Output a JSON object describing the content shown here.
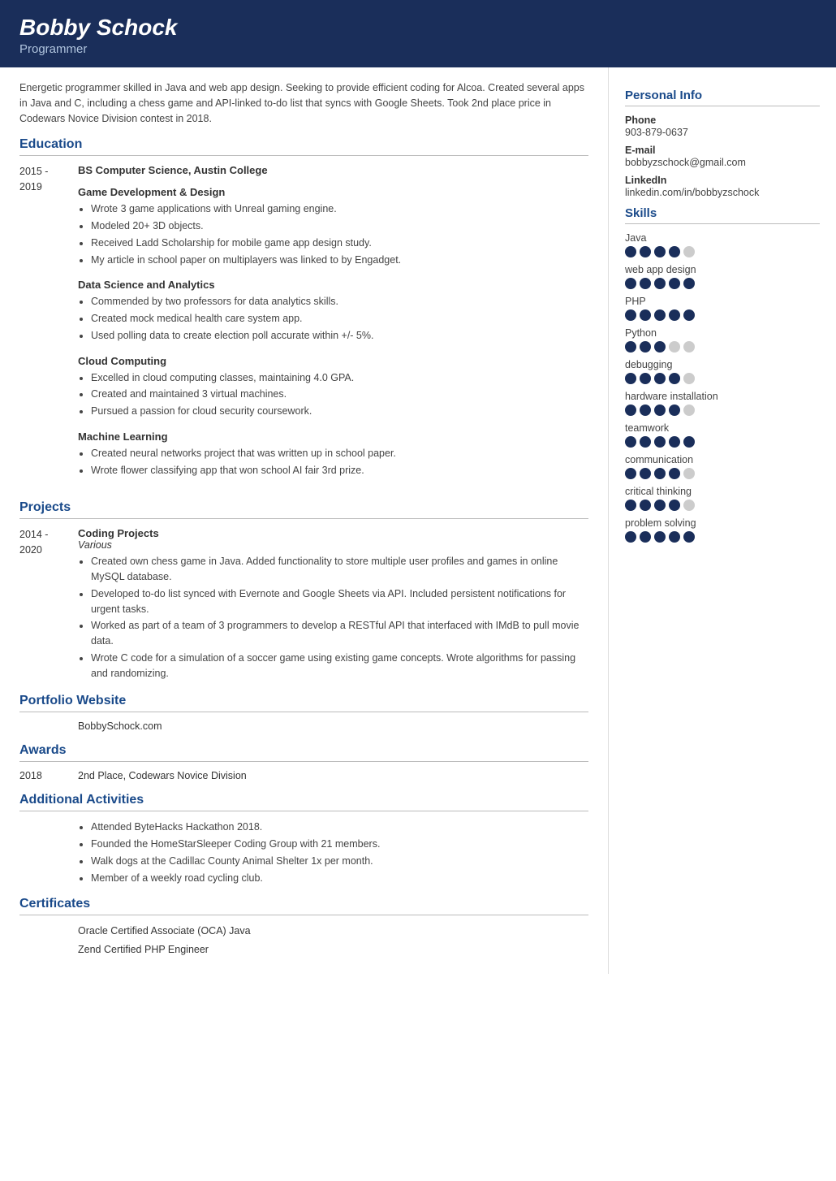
{
  "header": {
    "name": "Bobby Schock",
    "title": "Programmer"
  },
  "summary": "Energetic programmer skilled in Java and web app design. Seeking to provide efficient coding for Alcoa. Created several apps in Java and C, including a chess game and API-linked to-do list that syncs with Google Sheets. Took 2nd place price in Codewars Novice Division contest in 2018.",
  "sections": {
    "education": {
      "label": "Education",
      "entries": [
        {
          "years": "2015 -\n2019",
          "degree": "BS Computer Science, Austin College",
          "subsections": [
            {
              "title": "Game Development & Design",
              "bullets": [
                "Wrote 3 game applications with Unreal gaming engine.",
                "Modeled 20+ 3D objects.",
                "Received Ladd Scholarship for mobile game app design study.",
                "My article in school paper on multiplayers was linked to by Engadget."
              ]
            },
            {
              "title": "Data Science and Analytics",
              "bullets": [
                "Commended by two professors for data analytics skills.",
                "Created mock medical health care system app.",
                "Used polling data to create election poll accurate within +/- 5%."
              ]
            },
            {
              "title": "Cloud Computing",
              "bullets": [
                "Excelled in cloud computing classes, maintaining 4.0 GPA.",
                "Created and maintained 3 virtual machines.",
                "Pursued a passion for cloud security coursework."
              ]
            },
            {
              "title": "Machine Learning",
              "bullets": [
                "Created neural networks project that was written up in school paper.",
                "Wrote flower classifying app that won school AI fair 3rd prize."
              ]
            }
          ]
        }
      ]
    },
    "projects": {
      "label": "Projects",
      "entries": [
        {
          "years": "2014 -\n2020",
          "title": "Coding Projects",
          "subtitle": "Various",
          "bullets": [
            "Created own chess game in Java. Added functionality to store multiple user profiles and games in online MySQL database.",
            "Developed to-do list synced with Evernote and Google Sheets via API. Included persistent notifications for urgent tasks.",
            "Worked as part of a team of 3 programmers to develop a RESTful API that interfaced with IMdB to pull movie data.",
            "Wrote C code for a simulation of a soccer game using existing game concepts. Wrote algorithms for passing and randomizing."
          ]
        }
      ]
    },
    "portfolio": {
      "label": "Portfolio Website",
      "url": "BobbySchock.com"
    },
    "awards": {
      "label": "Awards",
      "entries": [
        {
          "year": "2018",
          "text": "2nd Place, Codewars Novice Division"
        }
      ]
    },
    "activities": {
      "label": "Additional Activities",
      "bullets": [
        "Attended ByteHacks Hackathon 2018.",
        "Founded the HomeStarSleeper Coding Group with 21 members.",
        "Walk dogs at the Cadillac County Animal Shelter 1x per month.",
        "Member of a weekly road cycling club."
      ]
    },
    "certificates": {
      "label": "Certificates",
      "items": [
        "Oracle Certified Associate (OCA) Java",
        "Zend Certified PHP Engineer"
      ]
    }
  },
  "sidebar": {
    "personal_info": {
      "label": "Personal Info",
      "phone_label": "Phone",
      "phone": "903-879-0637",
      "email_label": "E-mail",
      "email": "bobbyzschock@gmail.com",
      "linkedin_label": "LinkedIn",
      "linkedin": "linkedin.com/in/bobbyzschock"
    },
    "skills": {
      "label": "Skills",
      "items": [
        {
          "name": "Java",
          "filled": 4,
          "total": 5
        },
        {
          "name": "web app design",
          "filled": 5,
          "total": 5
        },
        {
          "name": "PHP",
          "filled": 5,
          "total": 5
        },
        {
          "name": "Python",
          "filled": 3,
          "total": 5
        },
        {
          "name": "debugging",
          "filled": 4,
          "total": 5
        },
        {
          "name": "hardware installation",
          "filled": 4,
          "total": 5
        },
        {
          "name": "teamwork",
          "filled": 5,
          "total": 5
        },
        {
          "name": "communication",
          "filled": 4,
          "total": 5
        },
        {
          "name": "critical thinking",
          "filled": 4,
          "total": 5
        },
        {
          "name": "problem solving",
          "filled": 5,
          "total": 5
        }
      ]
    }
  }
}
